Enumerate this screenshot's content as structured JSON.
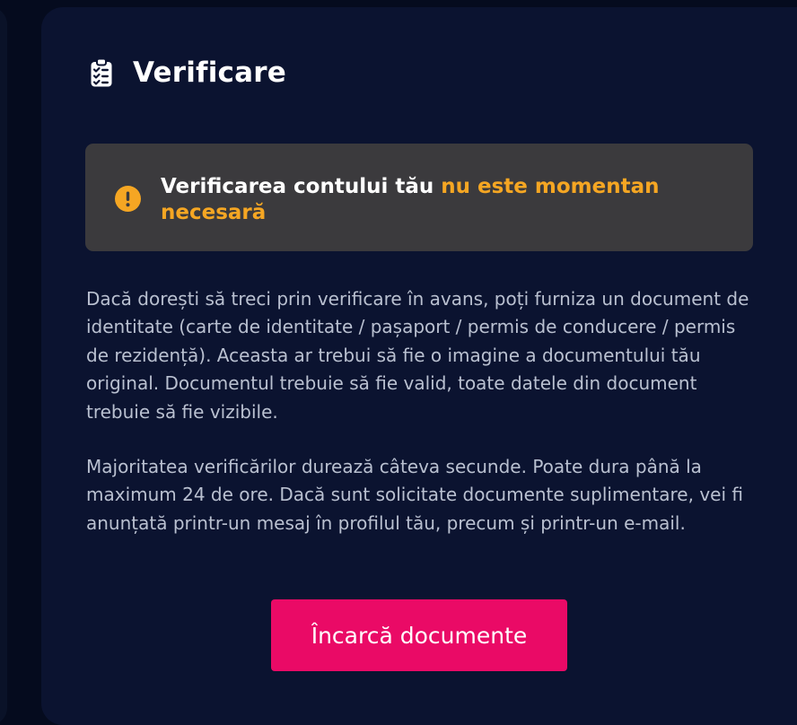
{
  "verification": {
    "title": "Verificare",
    "title_icon": "clipboard-checklist-icon",
    "notice": {
      "icon": "exclamation-circle-icon",
      "text_prefix": "Verificarea contului tău ",
      "text_highlight": "nu este momentan necesară",
      "highlight_color": "#f5a623"
    },
    "paragraph_1": "Dacă dorești să treci prin verificare în avans, poți furniza un document de identitate (carte de identitate / pașaport / permis de conducere / permis de rezidență). Aceasta ar trebui să fie o imagine a documentului tău original. Documentul trebuie să fie valid, toate datele din document trebuie să fie vizibile.",
    "paragraph_2": "Majoritatea verificărilor durează câteva secunde. Poate dura până la maximum 24 de ore. Dacă sunt solicitate documente suplimentare, vei fi anunțată printr-un mesaj în profilul tău, precum și printr-un e-mail.",
    "upload_button_label": "Încarcă documente",
    "button_color": "#ea0a66"
  }
}
